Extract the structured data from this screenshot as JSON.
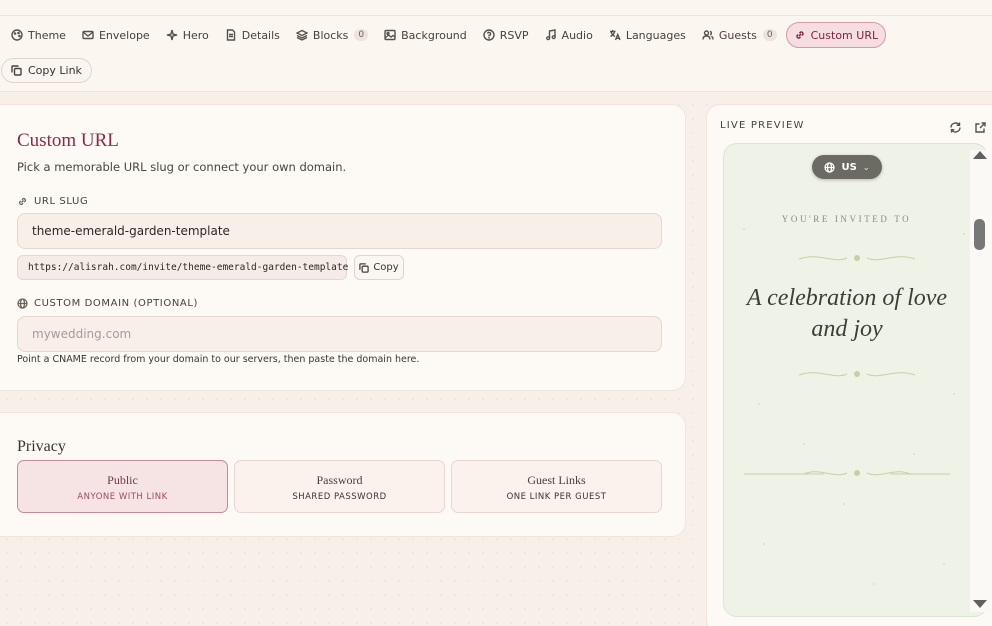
{
  "tabs": [
    {
      "label": "Theme",
      "icon": "palette-icon"
    },
    {
      "label": "Envelope",
      "icon": "envelope-icon"
    },
    {
      "label": "Hero",
      "icon": "sparkles-icon"
    },
    {
      "label": "Details",
      "icon": "document-icon"
    },
    {
      "label": "Blocks",
      "icon": "layers-icon",
      "count": "0"
    },
    {
      "label": "Background",
      "icon": "image-icon"
    },
    {
      "label": "RSVP",
      "icon": "question-circle-icon"
    },
    {
      "label": "Audio",
      "icon": "music-note-icon"
    },
    {
      "label": "Languages",
      "icon": "translate-icon"
    },
    {
      "label": "Guests",
      "icon": "users-icon",
      "count": "0"
    },
    {
      "label": "Custom URL",
      "icon": "link-icon",
      "active": true
    }
  ],
  "copy_link_label": "Copy Link",
  "custom_url": {
    "title": "Custom URL",
    "subtitle": "Pick a memorable URL slug or connect your own domain.",
    "slug_label": "URL SLUG",
    "slug_value": "theme-emerald-garden-template",
    "full_url": "https://alisrah.com/invite/theme-emerald-garden-template",
    "copy_label": "Copy",
    "domain_label": "CUSTOM DOMAIN (OPTIONAL)",
    "domain_placeholder": "mywedding.com",
    "domain_hint": "Point a CNAME record from your domain to our servers, then paste the domain here."
  },
  "privacy": {
    "title": "Privacy",
    "options": [
      {
        "title": "Public",
        "subtitle": "ANYONE WITH LINK",
        "selected": true
      },
      {
        "title": "Password",
        "subtitle": "SHARED PASSWORD",
        "selected": false
      },
      {
        "title": "Guest Links",
        "subtitle": "ONE LINK PER GUEST",
        "selected": false
      }
    ]
  },
  "preview": {
    "title": "LIVE PREVIEW",
    "language": "US",
    "invited_text": "YOU'RE INVITED TO",
    "headline": "A celebration of love and joy"
  },
  "colors": {
    "accent": "#8a2a4a",
    "active_tab_bg": "#f6dde2",
    "preview_bg": "#eff2e6",
    "page_bg": "#f8efe9"
  }
}
